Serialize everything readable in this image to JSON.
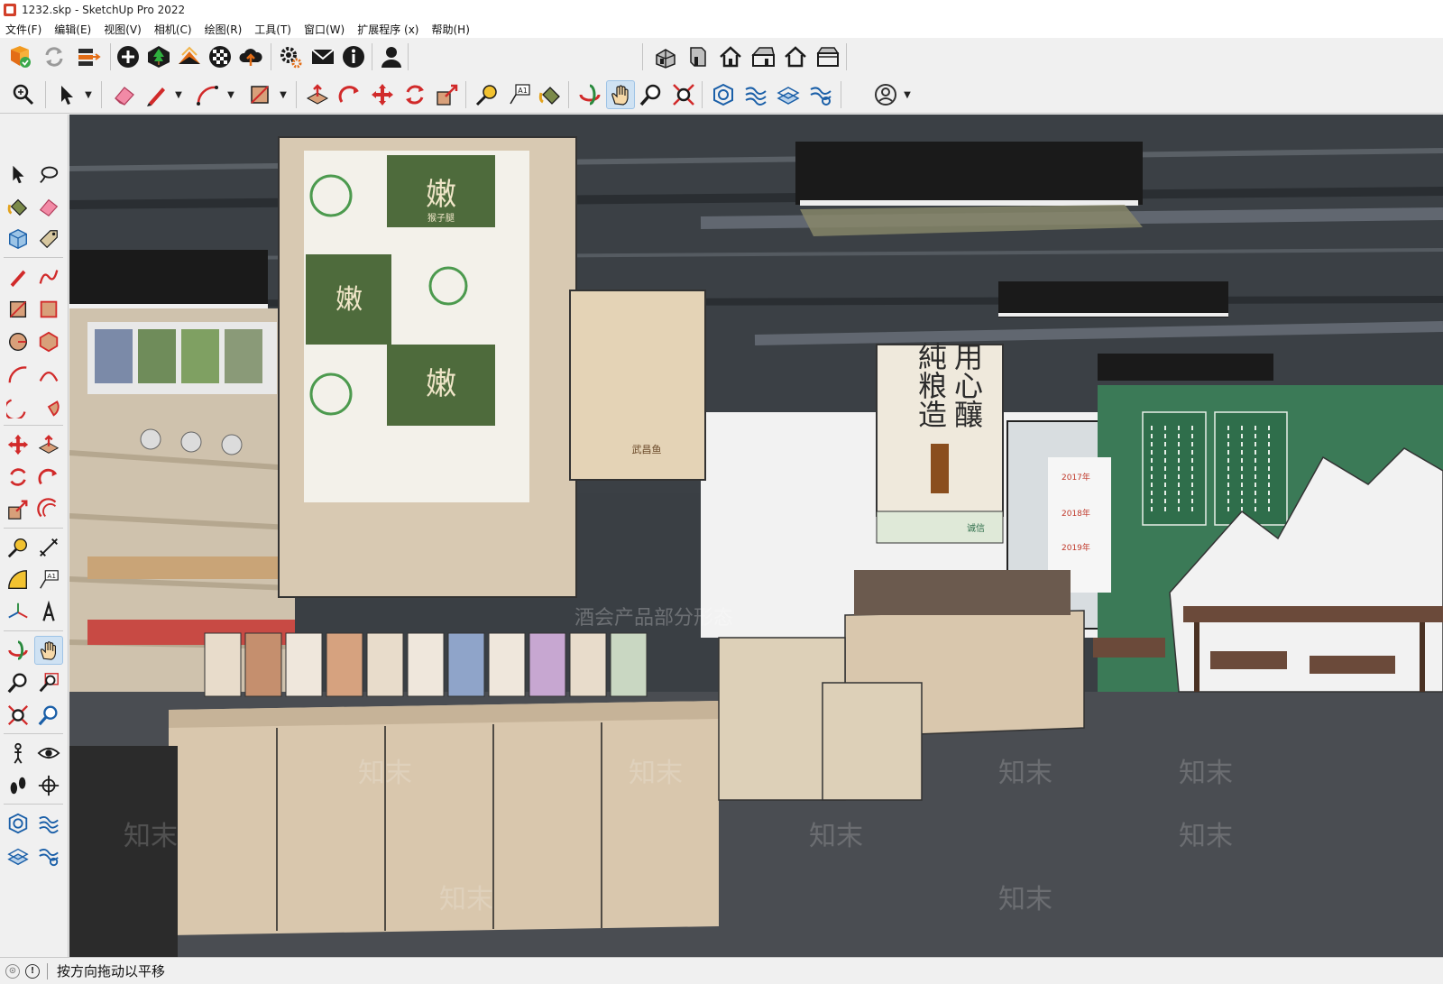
{
  "window": {
    "title": "1232.skp - SketchUp Pro 2022"
  },
  "menu": {
    "items": [
      {
        "label": "文件(F)"
      },
      {
        "label": "编辑(E)"
      },
      {
        "label": "视图(V)"
      },
      {
        "label": "相机(C)"
      },
      {
        "label": "绘图(R)"
      },
      {
        "label": "工具(T)"
      },
      {
        "label": "窗口(W)"
      },
      {
        "label": "扩展程序 (x)"
      },
      {
        "label": "帮助(H)"
      }
    ]
  },
  "viewport": {
    "signage": {
      "hanging_sign_lines": [
        "用心釀",
        "純粮造"
      ],
      "product_label": "嫩",
      "product_sublabel": "猴子腿",
      "brand_board": "武昌鱼",
      "small_sign": "诚信",
      "years": [
        "2017年",
        "2018年",
        "2019年"
      ],
      "watermark": "知末",
      "banner_text": "酒会产品部分形态"
    }
  },
  "toolbar": {
    "active_tool": "pan-tool",
    "row1_icons": [
      "extension-warehouse-icon",
      "sync-icon",
      "3d-warehouse-upload-icon",
      "add-location-icon",
      "terrain-icon",
      "layer-solid-icon",
      "checker-texture-icon",
      "cloud-upload-icon",
      "extension-manager-icon",
      "send-email-icon",
      "info-icon",
      "user-account-icon"
    ],
    "row1b_icons": [
      "iso-view-icon",
      "front-view-icon",
      "top-house-icon",
      "right-view-icon",
      "back-view-icon",
      "left-view-icon"
    ],
    "row2_icons": [
      "zoom-icon",
      "select-icon",
      "eraser-icon",
      "pencil-icon",
      "arc-icon",
      "rectangle-icon",
      "push-pull-icon",
      "follow-me-icon",
      "move-icon",
      "rotate-icon",
      "scale-icon",
      "tape-measure-icon",
      "text-icon",
      "paint-bucket-icon",
      "orbit-icon",
      "pan-icon",
      "zoom-tool-icon",
      "zoom-extents-icon",
      "solid-tools-icon",
      "sandbox-from-contours-icon",
      "sandbox-stamp-icon",
      "sandbox-flip-icon",
      "account-icon"
    ]
  },
  "status": {
    "message": "按方向拖动以平移",
    "geo_icon": "geolocation-icon",
    "info_icon": "credit-info-icon"
  },
  "colors": {
    "accent_active": "#cfe2f3",
    "wall_green": "#3b7a57",
    "shelf_wood": "#d9c7ad"
  }
}
